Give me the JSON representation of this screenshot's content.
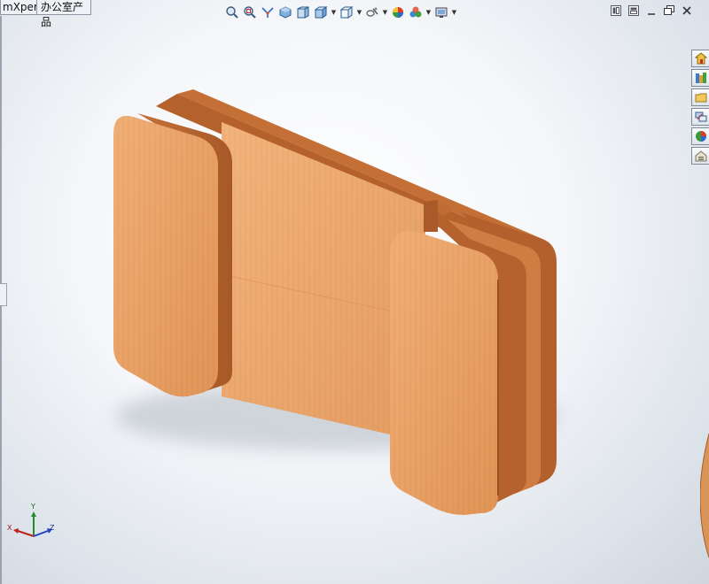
{
  "tabs": [
    {
      "label": "mXpert"
    },
    {
      "label": "办公室产品"
    }
  ],
  "heads_up_toolbar": {
    "items": [
      {
        "icon": "zoom-to-fit-icon"
      },
      {
        "icon": "zoom-to-area-icon"
      },
      {
        "icon": "previous-view-icon"
      },
      {
        "icon": "section-view-icon"
      },
      {
        "icon": "view-orientation-icon"
      },
      {
        "icon": "display-style-icon"
      },
      {
        "icon": "hide-show-items-icon"
      },
      {
        "icon": "edit-appearance-icon"
      },
      {
        "icon": "apply-scene-icon"
      },
      {
        "icon": "view-settings-icon"
      }
    ]
  },
  "window_controls": [
    "tile-icon",
    "restore-icon",
    "minimize-icon",
    "restore-window-icon",
    "close-icon"
  ],
  "task_pane": {
    "items": [
      {
        "icon": "solidworks-resources-icon"
      },
      {
        "icon": "design-library-icon"
      },
      {
        "icon": "file-explorer-icon"
      },
      {
        "icon": "view-palette-icon"
      },
      {
        "icon": "appearances-scenes-icon"
      },
      {
        "icon": "custom-properties-icon"
      }
    ]
  },
  "triad": {
    "x": "X",
    "y": "Y",
    "z": "Z"
  },
  "model": {
    "material": "wood",
    "colors": {
      "face": "#e9a368",
      "edge": "#b9652f",
      "dark": "#8f4620"
    }
  }
}
